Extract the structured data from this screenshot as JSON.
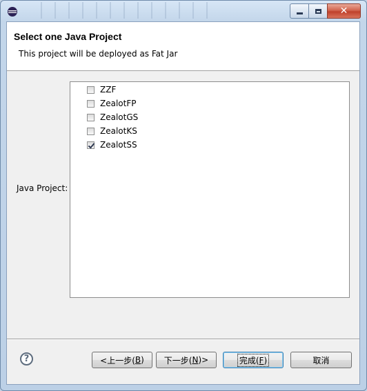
{
  "window": {
    "title": ""
  },
  "header": {
    "title": "Select one Java Project",
    "description": "This project will be deployed as Fat Jar"
  },
  "form": {
    "label": "Java Project:",
    "projects": [
      {
        "label": "ZZF",
        "checked": false
      },
      {
        "label": "ZealotFP",
        "checked": false
      },
      {
        "label": "ZealotGS",
        "checked": false
      },
      {
        "label": "ZealotKS",
        "checked": false
      },
      {
        "label": "ZealotSS",
        "checked": true
      }
    ]
  },
  "buttons": {
    "help_icon": "?",
    "back": "<上一步(",
    "back_key": "B",
    "back_end": ")",
    "next": "下一步(",
    "next_key": "N",
    "next_end": ")>",
    "finish": "完成(",
    "finish_key": "F",
    "finish_end": ")",
    "cancel": "取消"
  },
  "icons": {
    "app": "eclipse-icon",
    "help": "help-icon"
  },
  "colors": {
    "titlebar": "#c3d6ea",
    "close": "#c0412b",
    "default_button_border": "#3c7fb1"
  }
}
